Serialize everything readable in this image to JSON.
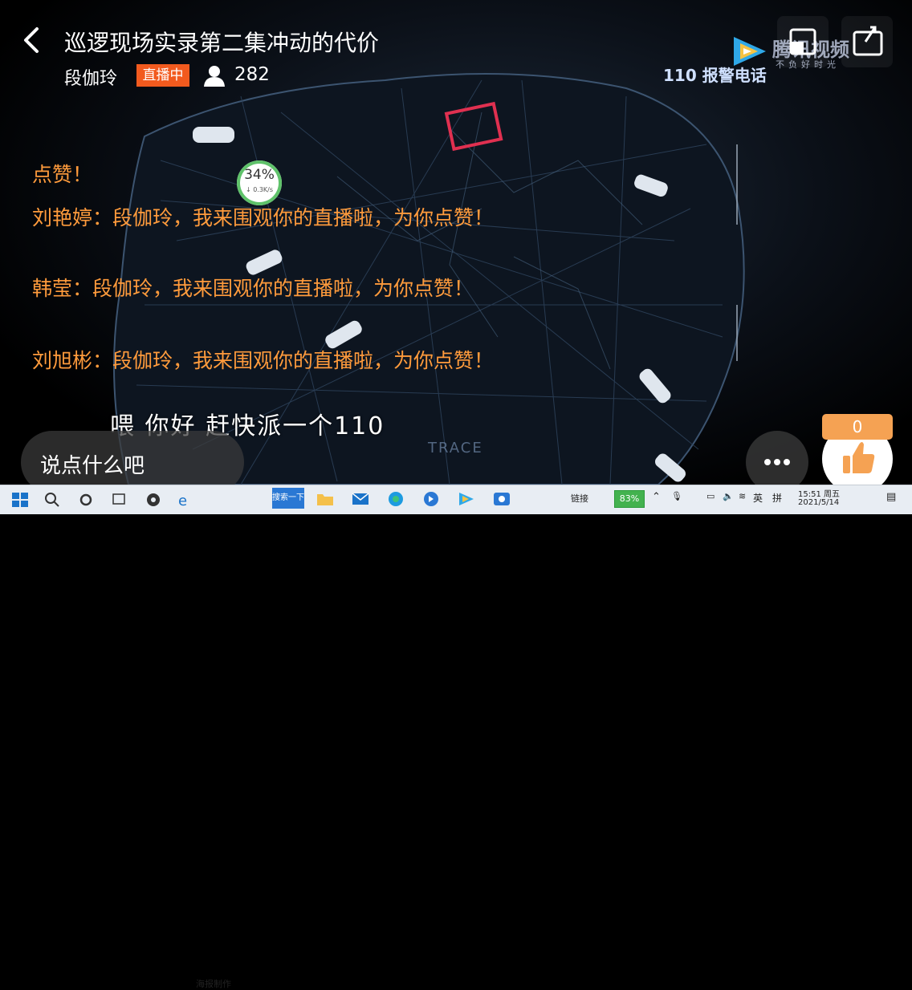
{
  "header": {
    "title": "巡逻现场实录第二集冲动的代价",
    "host_name": "段伽玲",
    "live_badge": "直播中",
    "viewer_count": "282"
  },
  "video": {
    "watermark": "腾讯视频",
    "watermark_sub": "不负好时光",
    "hotline": "110 报警电话",
    "subtitle": "喂 你好 赶快派一个110",
    "trace_label": "TRACE",
    "speed_percent": "34%",
    "speed_rate": "↓ 0.3K/s"
  },
  "comments": [
    {
      "text": "点赞！"
    },
    {
      "text": "刘艳婷：段伽玲，我来围观你的直播啦，为你点赞！"
    },
    {
      "text": "韩莹：段伽玲，我来围观你的直播啦，为你点赞！"
    },
    {
      "text": "刘旭彬：段伽玲，我来围观你的直播啦，为你点赞！"
    }
  ],
  "bottom_bar": {
    "input_placeholder": "说点什么吧",
    "like_count": "0"
  },
  "taskbar": {
    "browser_label": "海报制作",
    "search_label": "搜索一下",
    "link_label": "链接",
    "battery": "83%",
    "ime": "英",
    "ime2": "拼",
    "time": "15:51 周五",
    "date": "2021/5/14"
  },
  "colors": {
    "live_badge": "#f25a1e",
    "comment_text": "#ff9b3c",
    "like_count_bg": "#f5a253"
  }
}
